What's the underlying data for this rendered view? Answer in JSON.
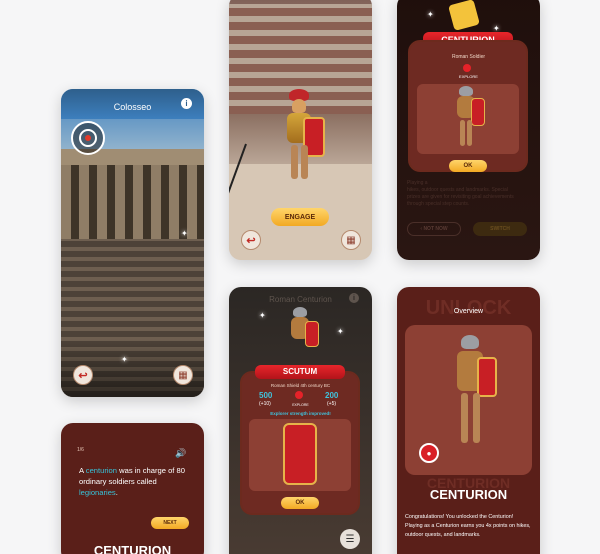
{
  "screen_colosseo": {
    "title": "Colosseo",
    "info_icon": "info-icon",
    "radar_icon": "radar-icon",
    "back_icon": "back-arrow-icon",
    "gallery_icon": "building-icon"
  },
  "screen_arena": {
    "engage_label": "ENGAGE",
    "back_icon": "back-arrow-icon",
    "gallery_icon": "building-icon"
  },
  "screen_unlock_dark": {
    "badge_title": "CENTURION",
    "badge_sub": "Roman Soldier",
    "explore_label": "EXPLORE",
    "ok_label": "OK",
    "bg_text_line1": "Playing a",
    "bg_text_line2": "hikes, outdoor quests and landmarks. Special",
    "bg_text_line3": "prizes are given for revisiting goal achievements",
    "bg_text_line4": "through special step counts.",
    "not_now_label": "NOT NOW",
    "switch_label": "SWITCH"
  },
  "screen_scutum": {
    "title": "Roman Centurion",
    "badge_title": "SCUTUM",
    "badge_sub": "Roman Shield 4th century BC",
    "stat_left": "500",
    "stat_left_delta": "(+10)",
    "stat_right": "200",
    "stat_right_delta": "(+5)",
    "explore_label": "EXPLORE",
    "improved_text": "Explorer strength improved!",
    "ok_label": "OK",
    "menu_icon": "menu-icon"
  },
  "screen_fact": {
    "counter": "1/6",
    "sound_icon": "speaker-icon",
    "fact_pre": "A ",
    "fact_hl1": "centurion",
    "fact_mid": " was in charge of 80 ordinary soldiers called ",
    "fact_hl2": "legionaries",
    "fact_post": ".",
    "next_label": "NEXT",
    "footer_title": "CENTURION"
  },
  "screen_overview": {
    "bg_word": "UNLOCK",
    "title": "Overview",
    "name": "CENTURION",
    "bg_name": "CENTURION",
    "desc": "Congratulations! You unlocked the Centurion! Playing as a Centurion earns you 4x points on hikes, outdoor quests, and landmarks.",
    "seal_icon": "seal-icon"
  },
  "colors": {
    "maroon": "#5a1b15",
    "maroon_mid": "#7a2a21",
    "red": "#d92027",
    "gold": "#f6b730",
    "cyan": "#37c3d9",
    "sky": "#2f7fc0"
  }
}
